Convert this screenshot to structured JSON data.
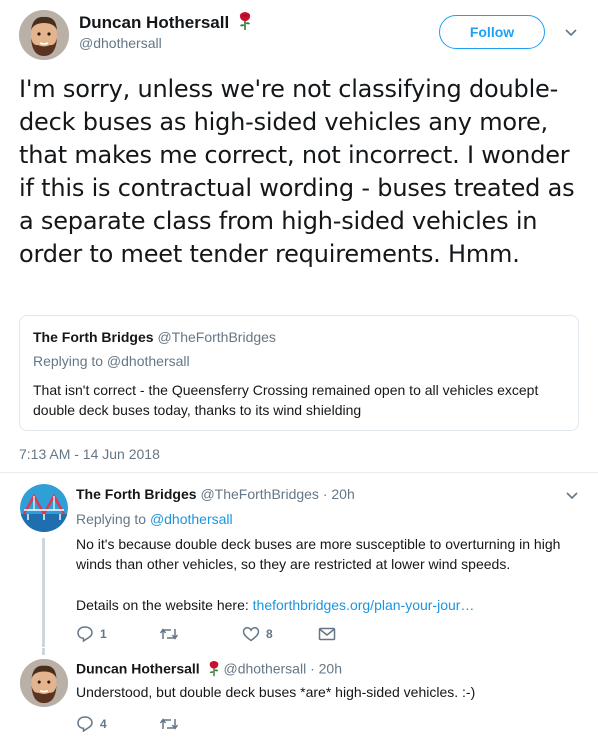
{
  "main_tweet": {
    "author_name": "Duncan Hothersall",
    "author_handle": "@dhothersall",
    "follow_label": "Follow",
    "text": "I'm sorry, unless we're not classifying double-deck buses as high-sided vehicles any more, that makes me correct, not incorrect. I wonder if this is contractual wording - buses treated as a separate class from high-sided vehicles in order to meet tender requirements. Hmm.",
    "quoted": {
      "author_name": "The Forth Bridges",
      "author_handle": "@TheForthBridges",
      "replying_to": "Replying to @dhothersall",
      "text": "That isn't correct - the Queensferry Crossing remained open to all vehicles except double deck buses today, thanks to its wind shielding"
    },
    "timestamp": "7:13 AM - 14 Jun 2018"
  },
  "replies": [
    {
      "author_name": "The Forth Bridges",
      "author_handle": "@TheForthBridges",
      "time": "· 20h",
      "replying_prefix": "Replying to",
      "replying_mention": "@dhothersall",
      "text": "No it's because double deck buses are more susceptible to overturning in high winds than other vehicles, so they are restricted at lower wind speeds.",
      "details_prefix": "Details on the website here:",
      "link_text": "theforthbridges.org/plan-your-jour…",
      "reply_count": "1",
      "retweet_count": "",
      "like_count": "8"
    },
    {
      "author_name": "Duncan Hothersall",
      "author_handle": "@dhothersall",
      "time": "· 20h",
      "text": "Understood, but double deck buses *are* high-sided vehicles. :-)",
      "reply_count": "4",
      "retweet_count": "",
      "like_count": ""
    }
  ],
  "icons": {
    "rose": "rose-icon",
    "caret": "chevron-down-icon",
    "reply": "reply-icon",
    "retweet": "retweet-icon",
    "like": "heart-icon",
    "dm": "envelope-icon"
  },
  "colors": {
    "accent": "#1da1f2",
    "link": "#1b95e0",
    "secondary_text": "#657786",
    "primary_text": "#14171a",
    "rose": "#c8102e",
    "divider": "#e6ecf0"
  }
}
